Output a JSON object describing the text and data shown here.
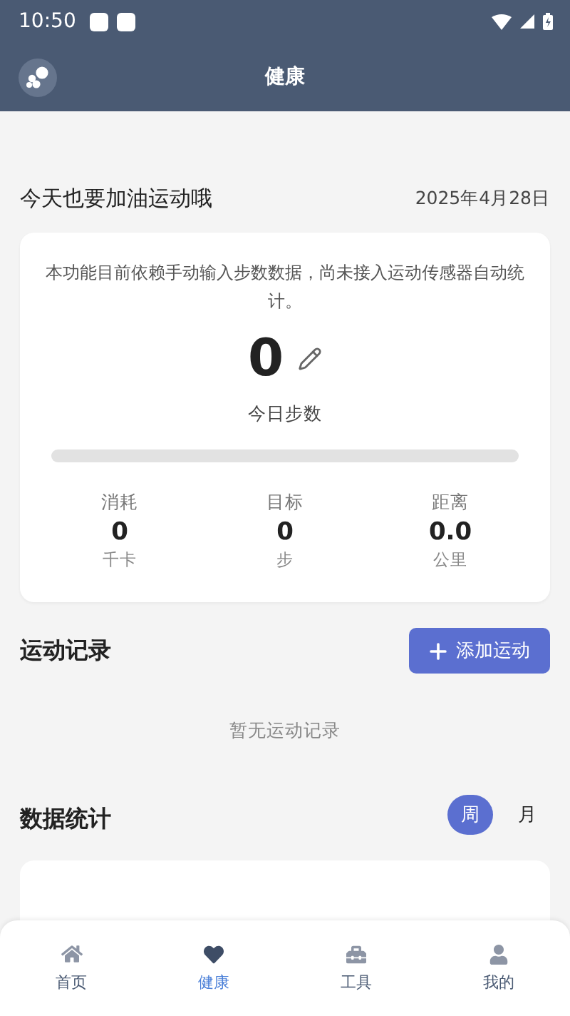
{
  "status_bar": {
    "time": "10:50"
  },
  "app_bar": {
    "title": "健康"
  },
  "greeting": {
    "text": "今天也要加油运动哦",
    "date": "2025年4月28日"
  },
  "steps_card": {
    "notice": "本功能目前依赖手动输入步数数据，尚未接入运动传感器自动统计。",
    "steps": "0",
    "steps_label": "今日步数",
    "level": 0,
    "stats": [
      {
        "label": "消耗",
        "value": "0",
        "unit": "千卡"
      },
      {
        "label": "目标",
        "value": "0",
        "unit": "步"
      },
      {
        "label": "距离",
        "value": "0.0",
        "unit": "公里"
      }
    ]
  },
  "records": {
    "title": "运动记录",
    "add_button": "添加运动",
    "empty_text": "暂无运动记录"
  },
  "statistics": {
    "title": "数据统计",
    "periods": [
      {
        "label": "周",
        "selected": true
      },
      {
        "label": "月",
        "selected": false
      }
    ]
  },
  "bottom_nav": [
    {
      "label": "首页",
      "kind": "home",
      "selected": false
    },
    {
      "label": "健康",
      "kind": "health",
      "selected": true
    },
    {
      "label": "工具",
      "kind": "tools",
      "selected": false
    },
    {
      "label": "我的",
      "kind": "profile",
      "selected": false
    }
  ]
}
